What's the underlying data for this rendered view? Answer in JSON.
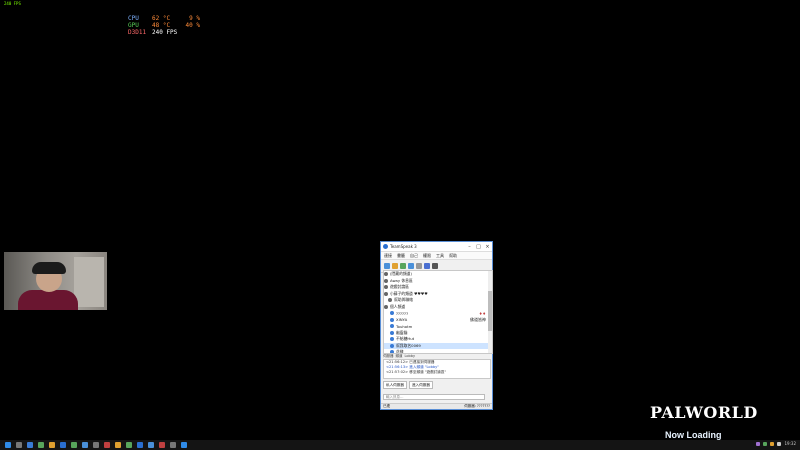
{
  "fps_text": "240 FPS",
  "osd": [
    {
      "label": "CPU",
      "v1": "62 °C",
      "v2": "9 %"
    },
    {
      "label": "GPU",
      "v1": "48 °C",
      "v2": "40 %"
    },
    {
      "label": "D3D11",
      "v1": "240 FPS",
      "v2": ""
    }
  ],
  "teamspeak": {
    "title": "TeamSpeak 3",
    "menu": [
      "連接",
      "書籤",
      "自己",
      "權限",
      "工具",
      "幫助"
    ],
    "tree": [
      {
        "label": "(隱藏的頻道)",
        "icon": "channel-icon",
        "color": "#666",
        "badge": ""
      },
      {
        "label": "Away 休息區",
        "icon": "channel-icon",
        "color": "#666",
        "badge": ""
      },
      {
        "label": "遊戲討論區",
        "icon": "channel-icon",
        "color": "#666",
        "badge": ""
      },
      {
        "label": "小蘇子的頻道 ♥♥♥♥",
        "icon": "channel-icon",
        "color": "#666",
        "badge": ""
      },
      {
        "label": "幫助與聯絡",
        "icon": "channel-icon",
        "color": "#666",
        "badge": ""
      },
      {
        "label": "個人頻道",
        "icon": "channel-icon",
        "color": "#666",
        "badge": ""
      },
      {
        "label": "??????",
        "icon": "user-icon",
        "color": "#3a7bd5",
        "badge": "♦♦"
      },
      {
        "label": "XINYA",
        "icon": "user-icon",
        "color": "#3a7bd5",
        "badge": "佛道皆神"
      },
      {
        "label": "Touhotm",
        "icon": "user-icon",
        "color": "#3a7bd5",
        "badge": ""
      },
      {
        "label": "幽靈貓",
        "icon": "user-icon",
        "color": "#3a7bd5",
        "badge": ""
      },
      {
        "label": "不給糖Hut",
        "icon": "user-icon",
        "color": "#3a7bd5",
        "badge": ""
      },
      {
        "label": "幫我取名0069",
        "icon": "user-icon",
        "color": "#3a7bd5",
        "badge": ""
      },
      {
        "label": "花樣",
        "icon": "user-icon",
        "color": "#3a7bd5",
        "badge": ""
      }
    ],
    "chat_tabs": [
      "伺服器",
      "頻道",
      "Lobby"
    ],
    "chat_lines": [
      "<21:56:12> 已連接到伺服器",
      "<21:56:13> 進入頻道 \"Lobby\"",
      "<21:57:02> 移至頻道 \"遊戲討論區\""
    ],
    "server_tabs": [
      "私人伺服器",
      "進入伺服器"
    ],
    "input_placeholder": "輸入訊息…",
    "status_left": "已連",
    "status_right": "伺服器: ???????"
  },
  "game": {
    "logo": "PALWORLD",
    "loading": "Now Loading"
  },
  "taskbar": {
    "clock": "19:32"
  }
}
